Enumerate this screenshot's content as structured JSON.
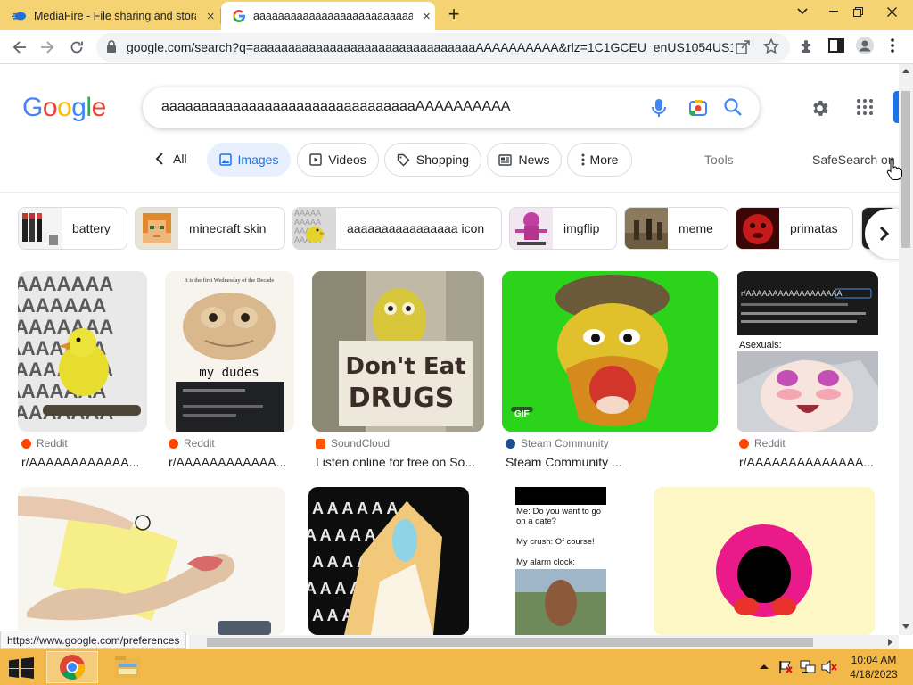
{
  "browser": {
    "tabs": [
      {
        "title": "MediaFire - File sharing and stora",
        "close": "×"
      },
      {
        "title": "aaaaaaaaaaaaaaaaaaaaaaaaaaa",
        "close": "×"
      }
    ],
    "new_tab": "+",
    "window_controls": {
      "minimize": "⌄",
      "restore": "–",
      "maximize": "❐",
      "close": "✕"
    },
    "url": "google.com/search?q=aaaaaaaaaaaaaaaaaaaaaaaaaaaaaaaaAAAAAAAAAA&rlz=1C1GCEU_enUS1054US105..."
  },
  "search": {
    "query": "aaaaaaaaaaaaaaaaaaaaaaaaaaaaaaaaAAAAAAAAAA"
  },
  "filters": {
    "all": "All",
    "images": "Images",
    "videos": "Videos",
    "shopping": "Shopping",
    "news": "News",
    "more": "More",
    "tools": "Tools",
    "safesearch": "SafeSearch on"
  },
  "related": [
    {
      "label": "battery"
    },
    {
      "label": "minecraft skin"
    },
    {
      "label": "aaaaaaaaaaaaaaaa icon"
    },
    {
      "label": "imgflip"
    },
    {
      "label": "meme"
    },
    {
      "label": "primatas"
    }
  ],
  "results": [
    {
      "source": "Reddit",
      "caption": "r/AAAAAAAAAAAA..."
    },
    {
      "source": "Reddit",
      "caption": "r/AAAAAAAAAAAA..."
    },
    {
      "source": "SoundCloud",
      "caption": "Listen online for free on So..."
    },
    {
      "source": "Steam Community",
      "caption": "Steam Community ...",
      "badge": "GIF"
    },
    {
      "source": "Reddit",
      "caption": "r/AAAAAAAAAAAAAA..."
    }
  ],
  "image_text": {
    "frog_top": "It is the first Wednesday of the Decade",
    "frog_bottom": "my dudes",
    "drugs_line1": "Don't Eat",
    "drugs_line2": "DRUGS",
    "ace_header": "r/AAAAAAAAAAAAAAAAAA",
    "ace_label": "Asexuals:",
    "date_l1": "Me: Do you want to go",
    "date_l2": "on a date?",
    "date_l3": "My crush: Of course!",
    "date_l4": "My alarm clock:"
  },
  "status_url": "https://www.google.com/preferences",
  "clock": {
    "time": "10:04 AM",
    "date": "4/18/2023"
  },
  "colors": {
    "google_blue": "#4285f4",
    "google_red": "#ea4335",
    "google_yellow": "#fbbc05",
    "google_green": "#34a853",
    "tab_strip": "#f5d373",
    "taskbar": "#f2b94a"
  }
}
